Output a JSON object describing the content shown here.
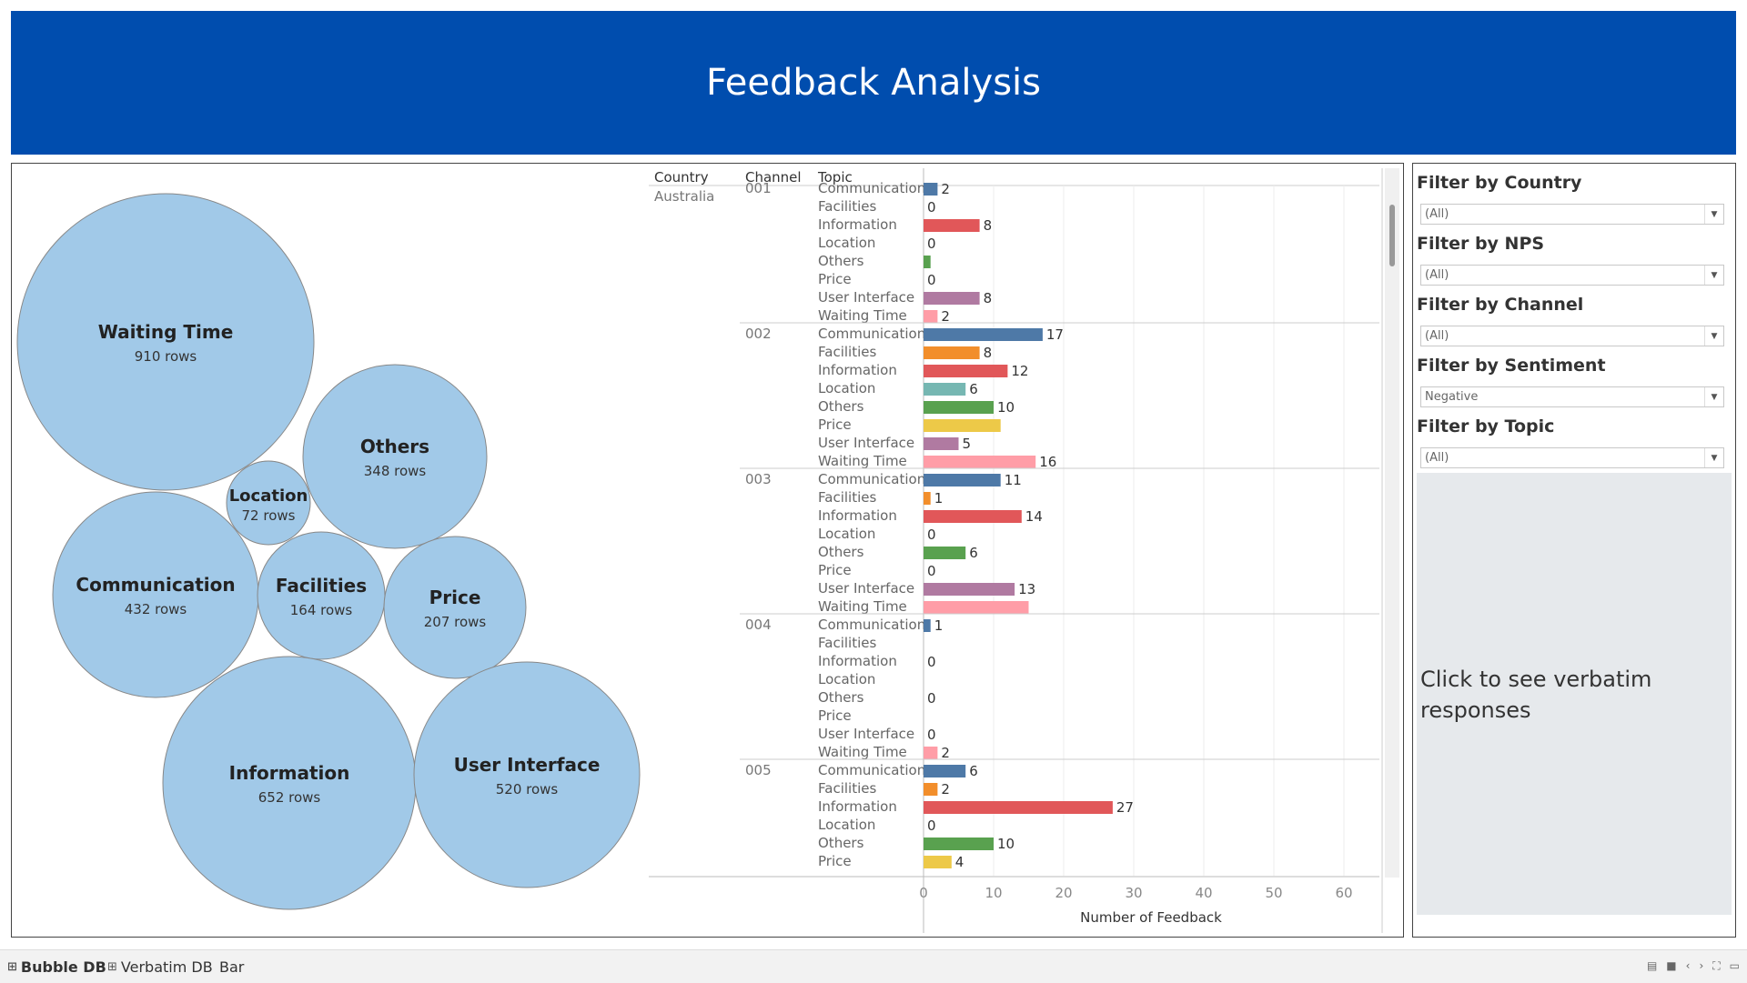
{
  "header": {
    "title": "Feedback Analysis"
  },
  "bubble_chart": {
    "items": [
      {
        "topic": "Waiting Time",
        "rows": "910 rows"
      },
      {
        "topic": "Others",
        "rows": "348 rows"
      },
      {
        "topic": "Location",
        "rows": "72 rows"
      },
      {
        "topic": "Communication",
        "rows": "432 rows"
      },
      {
        "topic": "Facilities",
        "rows": "164 rows"
      },
      {
        "topic": "Price",
        "rows": "207 rows"
      },
      {
        "topic": "Information",
        "rows": "652 rows"
      },
      {
        "topic": "User Interface",
        "rows": "520 rows"
      }
    ],
    "color": "#A1C9E8"
  },
  "chart_data": {
    "type": "bar",
    "orientation": "horizontal",
    "column_headers": [
      "Country",
      "Channel",
      "Topic"
    ],
    "country": "Australia",
    "xlabel": "Number of Feedback",
    "xticks": [
      0,
      10,
      20,
      30,
      40,
      50,
      60
    ],
    "xlim": [
      0,
      65
    ],
    "topics": [
      "Communication",
      "Facilities",
      "Information",
      "Location",
      "Others",
      "Price",
      "User Interface",
      "Waiting Time"
    ],
    "topic_colors": {
      "Communication": "#4E79A7",
      "Facilities": "#F28E2B",
      "Information": "#E15759",
      "Location": "#76B7B2",
      "Others": "#59A14F",
      "Price": "#EDC948",
      "User Interface": "#B07AA1",
      "Waiting Time": "#FF9DA7"
    },
    "channels": [
      {
        "channel": "001",
        "rows": [
          {
            "topic": "Communication",
            "value": 2,
            "label": "2"
          },
          {
            "topic": "Facilities",
            "value": 0,
            "label": "0"
          },
          {
            "topic": "Information",
            "value": 8,
            "label": "8"
          },
          {
            "topic": "Location",
            "value": 0,
            "label": "0"
          },
          {
            "topic": "Others",
            "value": 1,
            "label": ""
          },
          {
            "topic": "Price",
            "value": 0,
            "label": "0"
          },
          {
            "topic": "User Interface",
            "value": 8,
            "label": "8"
          },
          {
            "topic": "Waiting Time",
            "value": 2,
            "label": "2"
          }
        ]
      },
      {
        "channel": "002",
        "rows": [
          {
            "topic": "Communication",
            "value": 17,
            "label": "17"
          },
          {
            "topic": "Facilities",
            "value": 8,
            "label": "8"
          },
          {
            "topic": "Information",
            "value": 12,
            "label": "12"
          },
          {
            "topic": "Location",
            "value": 6,
            "label": "6"
          },
          {
            "topic": "Others",
            "value": 10,
            "label": "10"
          },
          {
            "topic": "Price",
            "value": 11,
            "label": ""
          },
          {
            "topic": "User Interface",
            "value": 5,
            "label": "5"
          },
          {
            "topic": "Waiting Time",
            "value": 16,
            "label": "16"
          }
        ]
      },
      {
        "channel": "003",
        "rows": [
          {
            "topic": "Communication",
            "value": 11,
            "label": "11"
          },
          {
            "topic": "Facilities",
            "value": 1,
            "label": "1"
          },
          {
            "topic": "Information",
            "value": 14,
            "label": "14"
          },
          {
            "topic": "Location",
            "value": 0,
            "label": "0"
          },
          {
            "topic": "Others",
            "value": 6,
            "label": "6"
          },
          {
            "topic": "Price",
            "value": 0,
            "label": "0"
          },
          {
            "topic": "User Interface",
            "value": 13,
            "label": "13"
          },
          {
            "topic": "Waiting Time",
            "value": 15,
            "label": ""
          }
        ]
      },
      {
        "channel": "004",
        "rows": [
          {
            "topic": "Communication",
            "value": 1,
            "label": "1"
          },
          {
            "topic": "Facilities",
            "value": 0,
            "label": ""
          },
          {
            "topic": "Information",
            "value": 0,
            "label": "0"
          },
          {
            "topic": "Location",
            "value": 0,
            "label": ""
          },
          {
            "topic": "Others",
            "value": 0,
            "label": "0"
          },
          {
            "topic": "Price",
            "value": 0,
            "label": ""
          },
          {
            "topic": "User Interface",
            "value": 0,
            "label": "0"
          },
          {
            "topic": "Waiting Time",
            "value": 2,
            "label": "2"
          }
        ]
      },
      {
        "channel": "005",
        "rows": [
          {
            "topic": "Communication",
            "value": 6,
            "label": "6"
          },
          {
            "topic": "Facilities",
            "value": 2,
            "label": "2"
          },
          {
            "topic": "Information",
            "value": 27,
            "label": "27"
          },
          {
            "topic": "Location",
            "value": 0,
            "label": "0"
          },
          {
            "topic": "Others",
            "value": 10,
            "label": "10"
          },
          {
            "topic": "Price",
            "value": 4,
            "label": "4"
          }
        ]
      }
    ]
  },
  "filters": [
    {
      "title": "Filter by Country",
      "value": "(All)"
    },
    {
      "title": "Filter by NPS",
      "value": "(All)"
    },
    {
      "title": "Filter by Channel",
      "value": "(All)"
    },
    {
      "title": "Filter by Sentiment",
      "value": "Negative"
    },
    {
      "title": "Filter by Topic",
      "value": "(All)"
    }
  ],
  "verbatim": {
    "text": "Click to see verbatim responses"
  },
  "tabs": [
    {
      "label": "Bubble DB",
      "icon": "grid-icon",
      "active": true
    },
    {
      "label": "Verbatim DB",
      "icon": "grid-icon",
      "active": false
    },
    {
      "label": "Bar",
      "icon": "",
      "active": false
    }
  ]
}
